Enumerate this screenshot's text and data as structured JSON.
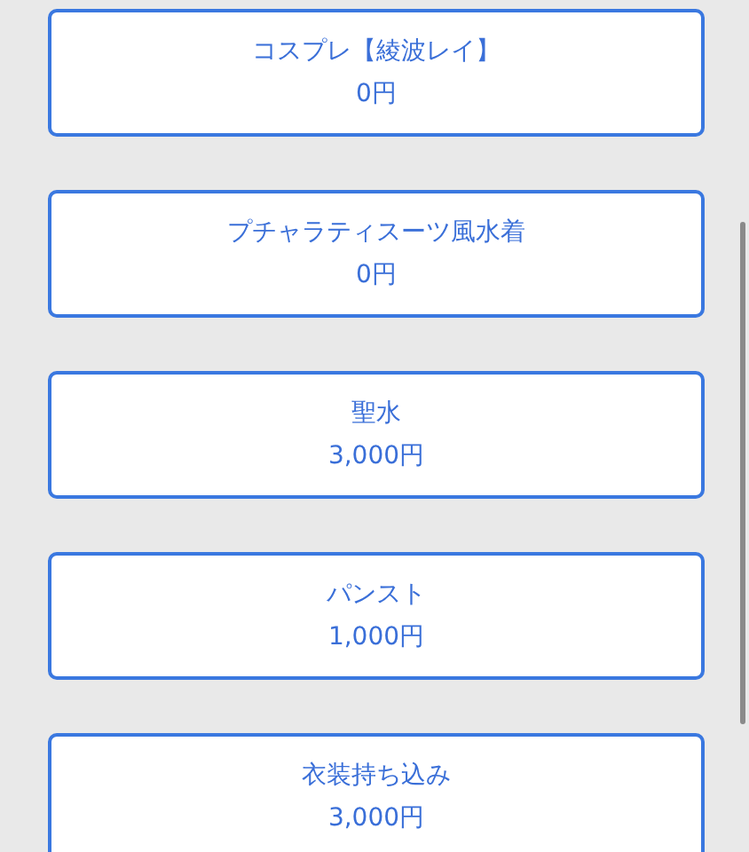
{
  "options": [
    {
      "name": "コスプレ【綾波レイ】",
      "price": "0円"
    },
    {
      "name": "プチャラティスーツ風水着",
      "price": "0円"
    },
    {
      "name": "聖水",
      "price": "3,000円"
    },
    {
      "name": "パンスト",
      "price": "1,000円"
    },
    {
      "name": "衣装持ち込み",
      "price": "3,000円"
    }
  ]
}
